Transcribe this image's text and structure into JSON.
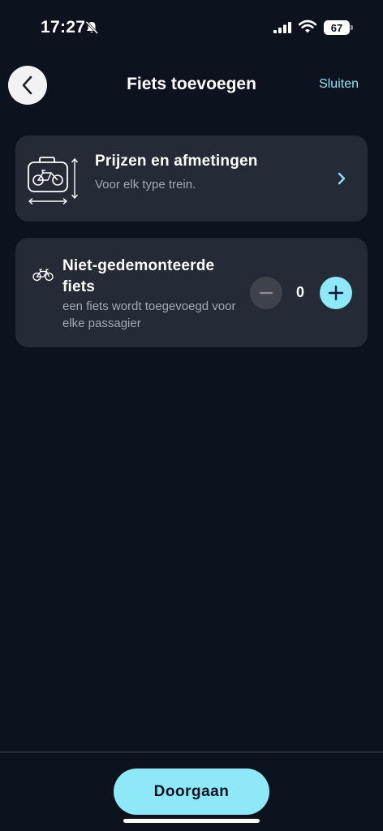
{
  "status_bar": {
    "time": "17:27",
    "battery": "67",
    "icons": [
      "bell-slash-icon",
      "signal-icon",
      "wifi-icon",
      "battery-icon"
    ]
  },
  "header": {
    "title": "Fiets toevoegen",
    "close_label": "Sluiten",
    "back_icon": "chevron-left-icon"
  },
  "prices_card": {
    "icon": "luggage-dimensions-icon",
    "title": "Prijzen en afmetingen",
    "subtitle": "Voor elk type trein.",
    "chevron_icon": "chevron-right-icon"
  },
  "bike_card": {
    "icon": "bike-icon",
    "title": "Niet-gedemonteerde fiets",
    "subtitle": "een fiets wordt toegevoegd voor elke passagier",
    "quantity": "0",
    "minus_icon": "minus-icon",
    "plus_icon": "plus-icon"
  },
  "footer": {
    "continue_label": "Doorgaan"
  },
  "colors": {
    "background": "#0c121e",
    "card": "#242a36",
    "accent": "#8ee8f8",
    "muted_text": "#a4a9b3"
  }
}
